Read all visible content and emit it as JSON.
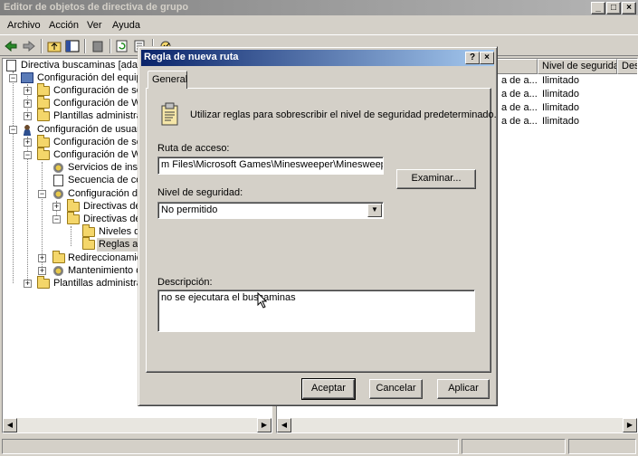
{
  "window": {
    "title": "Editor de objetos de directiva de grupo",
    "min": "_",
    "max": "□",
    "close": "×"
  },
  "menu": [
    "Archivo",
    "Acción",
    "Ver",
    "Ayuda"
  ],
  "tree": {
    "root": "Directiva buscaminas [adan-xw",
    "items": [
      "Configuración del equipo",
      "Configuración de softw",
      "Configuración de Wind",
      "Plantillas administrativa",
      "Configuración de usuario",
      "Configuración de softw",
      "Configuración de Wind",
      "Servicios de instala",
      "Secuencia de coma",
      "Configuración de s",
      "Directivas de c",
      "Directivas de r",
      "Niveles de",
      "Reglas adic",
      "Redireccionamiento",
      "Mantenimiento de :",
      "Plantillas administrativa"
    ]
  },
  "list": {
    "columns": [
      "",
      "Nivel de seguridad",
      "Des"
    ],
    "rows": [
      {
        "col1": "a de a...",
        "level": "Ilimitado"
      },
      {
        "col1": "a de a...",
        "level": "Ilimitado"
      },
      {
        "col1": "a de a...",
        "level": "Ilimitado"
      },
      {
        "col1": "a de a...",
        "level": "Ilimitado"
      }
    ]
  },
  "dialog": {
    "title": "Regla de nueva ruta",
    "help": "?",
    "close": "×",
    "tab": "General",
    "intro": "Utilizar reglas para sobrescribir el nivel de seguridad predeterminado.",
    "path_label": "Ruta de acceso:",
    "path_value": "m Files\\Microsoft Games\\Minesweeper\\Minesweeper.exe",
    "browse": "Examinar...",
    "level_label": "Nivel de seguridad:",
    "level_value": "No permitido",
    "desc_label": "Descripción:",
    "desc_value": "no se ejecutara el buscaminas",
    "ok": "Aceptar",
    "cancel": "Cancelar",
    "apply": "Aplicar"
  }
}
